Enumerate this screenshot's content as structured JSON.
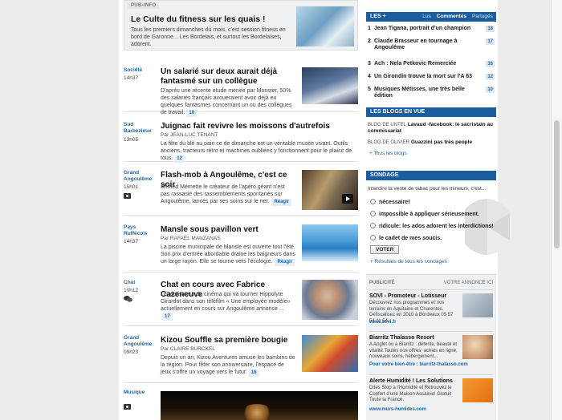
{
  "promo": {
    "tag": "PUB-INFO",
    "title": "Le Culte du fitness sur les quais !",
    "text": "Tous les premiers dimanches du mois, c'est session fitness en bord de Garonne... Les Bordelais, et surtout les Bordelaises, adorent."
  },
  "articles": [
    {
      "category": "Société",
      "time": "14h37",
      "title": "Un salarié sur deux aurait déjà fantasmé sur un collègue",
      "author": "",
      "text": "D'après une récente étude menée par Monster, 50% des salariés français avoueraient avoir déjà eu quelques fantasmes concernant un ou des collègues de travail.",
      "comments": "10",
      "reagir": ""
    },
    {
      "category": "Sud Barbezieux",
      "time": "13h05",
      "title": "Juignac fait revivre les moissons d'autrefois",
      "author": "Par JEAN-LUC TENANT",
      "text": "La fête du blé au pain ce de dimanche est un véritable musée vivant. Outils anciens, tracteurs rétro et machines oubliées y fonctionnent pour le plaisir de tous.",
      "comments": "12",
      "reagir": ""
    },
    {
      "category": "Grand Angoulême",
      "time": "15h01",
      "title": "Flash-mob à Angoulême, c'est ce soir",
      "author": "",
      "text": "Ahmed Mémette le créateur de l'apéro géant n'est pas rassasié des rassemblements spontanés sur Angoulême, lancés par ses soins sur le net.",
      "comments": "",
      "reagir": "Réagir"
    },
    {
      "category": "Pays Ruffécois",
      "time": "14h37",
      "title": "Mansle sous pavillon vert",
      "author": "Par RAFAEL MANZANAS",
      "text": "La piscine municipale de Mansle est ouverte tout l'été. Son prix d'entrée abordable draine les baigneurs dans un large rayon. Elle se tourne vers l'écologie.",
      "comments": "",
      "reagir": "Réagir"
    },
    {
      "category": "Chat",
      "time": "10h12",
      "title": "Chat en cours avec Fabrice Cazeneuve",
      "author": "",
      "text": "Le réalisateur de cinéma qui va tourner Hippolyte Girardot dans son téléfilm « Une employée modèle» actuellement en cours sur Angoulême annonce ...",
      "comments": "17",
      "reagir": ""
    },
    {
      "category": "Grand Angoulême",
      "time": "09h23",
      "title": "Kizou Souffle sa première bougie",
      "author": "Par CLAIRE BURCKEL",
      "text": "Depuis un an, Kizou Aventures amuse les bambins de la région. Pour fêter son anniversaire, l'espace de jeux s'offre un voyage vers le futur.",
      "comments": "16",
      "reagir": ""
    },
    {
      "category": "Musique",
      "time": "",
      "title": "",
      "author": "",
      "text": "",
      "comments": "",
      "reagir": ""
    }
  ],
  "les": {
    "title": "LES +",
    "tabs": [
      "Lus",
      "Commentés",
      "Partagés"
    ],
    "items": [
      {
        "num": "1",
        "label": "Jean Tigana, portrait d'un champion",
        "count": "18"
      },
      {
        "num": "2",
        "label": "Claude Brasseur en tournage à Angoulême",
        "count": "17"
      },
      {
        "num": "3",
        "label": "Ach : Nela Petkovic Remerciée",
        "count": "16"
      },
      {
        "num": "4",
        "label": "Un Girondin trouve la mort sur l'A 63",
        "count": "12"
      },
      {
        "num": "5",
        "label": "Musiques Métisses, une très belle édition",
        "count": "10"
      }
    ]
  },
  "blogs": {
    "title": "LES BLOGS EN VUE",
    "items": [
      {
        "who": "BLOG DE UNTEL",
        "what": "Lavaud -facebook: le sacristain au commissariat"
      },
      {
        "who": "BLOG DE OLIVIER",
        "what": "Guazzini pas très people"
      }
    ],
    "all": "+ Tous les blogs"
  },
  "sondage": {
    "title": "SONDAGE",
    "question": "Interdire la vente de tabac pour les mineurs, c'est...",
    "options": [
      "nécessaire!",
      "impossible à appliquer sérieusement.",
      "ridicule: les ados adorent les interdictions!",
      "le cadet de mes soucis."
    ],
    "vote": "VOTER",
    "results": "+ Résultats de tous les sondages"
  },
  "pub": {
    "label": "PUBLICITÉ",
    "right": "VOTRE ANNONCE ICI",
    "ads": [
      {
        "title": "SOVI - Promoteur - Lotisseur",
        "text": "Découvrez nos programmes et nos terrains en Aquitaine et Charentes. Défiscalisez en 2010 à Bordeaux 05 57 54 11 54",
        "link": "www.sovi.fr"
      },
      {
        "title": "Biarritz Thalasso Resort",
        "text": "A Anglet ou à Biarritz : détente, beauté et vitalité.Toutes nos offres: achats en ligne, nouveaux soins, hébergement...",
        "link": "Pour votre bien-être : biarritz-thalasso.com"
      },
      {
        "title": "Alerte Humidité ! Les Solutions",
        "text": "Dites Stop à l'Humidité et Retrouvez le Confort d'une Maison Assainie! Gratuit Toute la France.",
        "link": "www.murs-humides.com"
      }
    ]
  }
}
